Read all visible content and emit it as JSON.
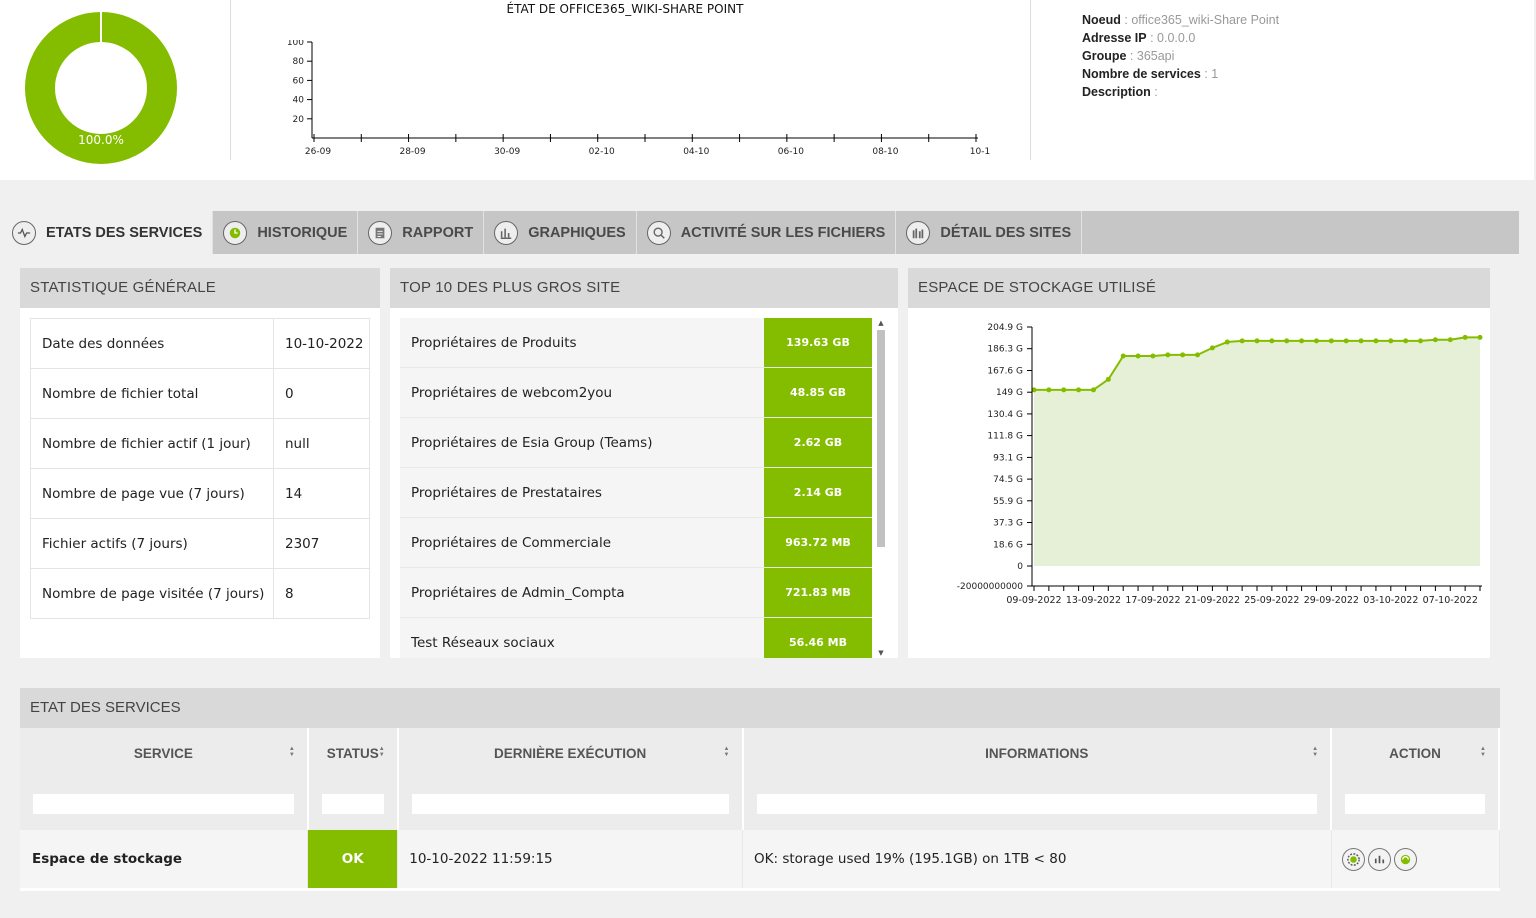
{
  "top": {
    "donut_label": "100.0%",
    "state_title": "ÉTAT DE OFFICE365_WIKI-SHARE POINT",
    "info": [
      {
        "label": "Noeud",
        "value": "office365_wiki-Share Point"
      },
      {
        "label": "Adresse IP",
        "value": "0.0.0.0"
      },
      {
        "label": "Groupe",
        "value": "365api"
      },
      {
        "label": "Nombre de services",
        "value": "1"
      },
      {
        "label": "Description",
        "value": ""
      }
    ]
  },
  "tabs": [
    {
      "label": "ETATS DES SERVICES",
      "icon": "heartbeat-icon",
      "active": true
    },
    {
      "label": "HISTORIQUE",
      "icon": "clock-icon",
      "active": false
    },
    {
      "label": "RAPPORT",
      "icon": "document-icon",
      "active": false
    },
    {
      "label": "GRAPHIQUES",
      "icon": "bar-chart-icon",
      "active": false
    },
    {
      "label": "ACTIVITÉ SUR LES FICHIERS",
      "icon": "file-search-icon",
      "active": false
    },
    {
      "label": "DÉTAIL DES SITES",
      "icon": "sites-icon",
      "active": false
    }
  ],
  "stats": {
    "title": "STATISTIQUE GÉNÉRALE",
    "rows": [
      {
        "k": "Date des données",
        "v": "10-10-2022"
      },
      {
        "k": "Nombre de fichier total",
        "v": "0"
      },
      {
        "k": "Nombre de fichier actif (1 jour)",
        "v": "null"
      },
      {
        "k": "Nombre de page vue (7 jours)",
        "v": "14"
      },
      {
        "k": "Fichier actifs (7 jours)",
        "v": "2307"
      },
      {
        "k": "Nombre de page visitée (7 jours)",
        "v": "8"
      }
    ]
  },
  "top10": {
    "title": "TOP 10 DES PLUS GROS SITE",
    "rows": [
      {
        "name": "Propriétaires de Produits",
        "size": "139.63 GB"
      },
      {
        "name": "Propriétaires de webcom2you",
        "size": "48.85 GB"
      },
      {
        "name": "Propriétaires de Esia Group (Teams)",
        "size": "2.62 GB"
      },
      {
        "name": "Propriétaires de Prestataires",
        "size": "2.14 GB"
      },
      {
        "name": "Propriétaires de Commerciale",
        "size": "963.72 MB"
      },
      {
        "name": "Propriétaires de Admin_Compta",
        "size": "721.83 MB"
      },
      {
        "name": "Test Réseaux sociaux",
        "size": "56.46 MB"
      }
    ]
  },
  "storage": {
    "title": "ESPACE DE STOCKAGE UTILISÉ"
  },
  "services": {
    "title": "ETAT DES SERVICES",
    "columns": [
      "SERVICE",
      "STATUS",
      "DERNIÈRE EXÉCUTION",
      "INFORMATIONS",
      "ACTION"
    ],
    "rows": [
      {
        "service": "Espace de stockage",
        "status": "OK",
        "last_run": "10-10-2022 11:59:15",
        "info": "OK: storage used 19% (195.1GB) on 1TB < 80"
      }
    ]
  },
  "colors": {
    "accent": "#84bd00",
    "area": "#e6f0d6"
  },
  "chart_data": [
    {
      "type": "pie",
      "name": "",
      "values": [
        100.0
      ],
      "labels": [
        "100.0%"
      ]
    },
    {
      "type": "line",
      "title": "ÉTAT DE OFFICE365_WIKI-SHARE POINT",
      "x_ticks": [
        "26-09",
        "28-09",
        "30-09",
        "02-10",
        "04-10",
        "06-10",
        "08-10",
        "10-1"
      ],
      "y_ticks": [
        20,
        40,
        60,
        80,
        100
      ],
      "ylim": [
        0,
        100
      ],
      "series": []
    },
    {
      "type": "area",
      "title": "ESPACE DE STOCKAGE UTILISÉ",
      "x_ticks": [
        "09-09-2022",
        "13-09-2022",
        "17-09-2022",
        "21-09-2022",
        "25-09-2022",
        "29-09-2022",
        "03-10-2022",
        "07-10-2022"
      ],
      "y_tick_labels": [
        "-20000000000",
        "0",
        "18.6 G",
        "37.3 G",
        "55.9 G",
        "74.5 G",
        "93.1 G",
        "111.8 G",
        "130.4 G",
        "149 G",
        "167.6 G",
        "186.3 G",
        "204.9 G"
      ],
      "y_tick_values": [
        -20,
        0,
        18.6,
        37.3,
        55.9,
        74.5,
        93.1,
        111.8,
        130.4,
        149,
        167.6,
        186.3,
        204.9
      ],
      "ylim": [
        -20,
        210
      ],
      "x_dates": [
        "09-09",
        "10-09",
        "11-09",
        "12-09",
        "13-09",
        "14-09",
        "15-09",
        "16-09",
        "17-09",
        "18-09",
        "19-09",
        "20-09",
        "21-09",
        "22-09",
        "23-09",
        "24-09",
        "25-09",
        "26-09",
        "27-09",
        "28-09",
        "29-09",
        "30-09",
        "01-10",
        "02-10",
        "03-10",
        "04-10",
        "05-10",
        "06-10",
        "07-10",
        "08-10",
        "09-10"
      ],
      "values": [
        151,
        151,
        151,
        151,
        151,
        160,
        180,
        180,
        180,
        181,
        181,
        181,
        187,
        192,
        193,
        193,
        193,
        193,
        193,
        193,
        193,
        193,
        193,
        193,
        193,
        193,
        193,
        194,
        194,
        196,
        196
      ]
    }
  ]
}
